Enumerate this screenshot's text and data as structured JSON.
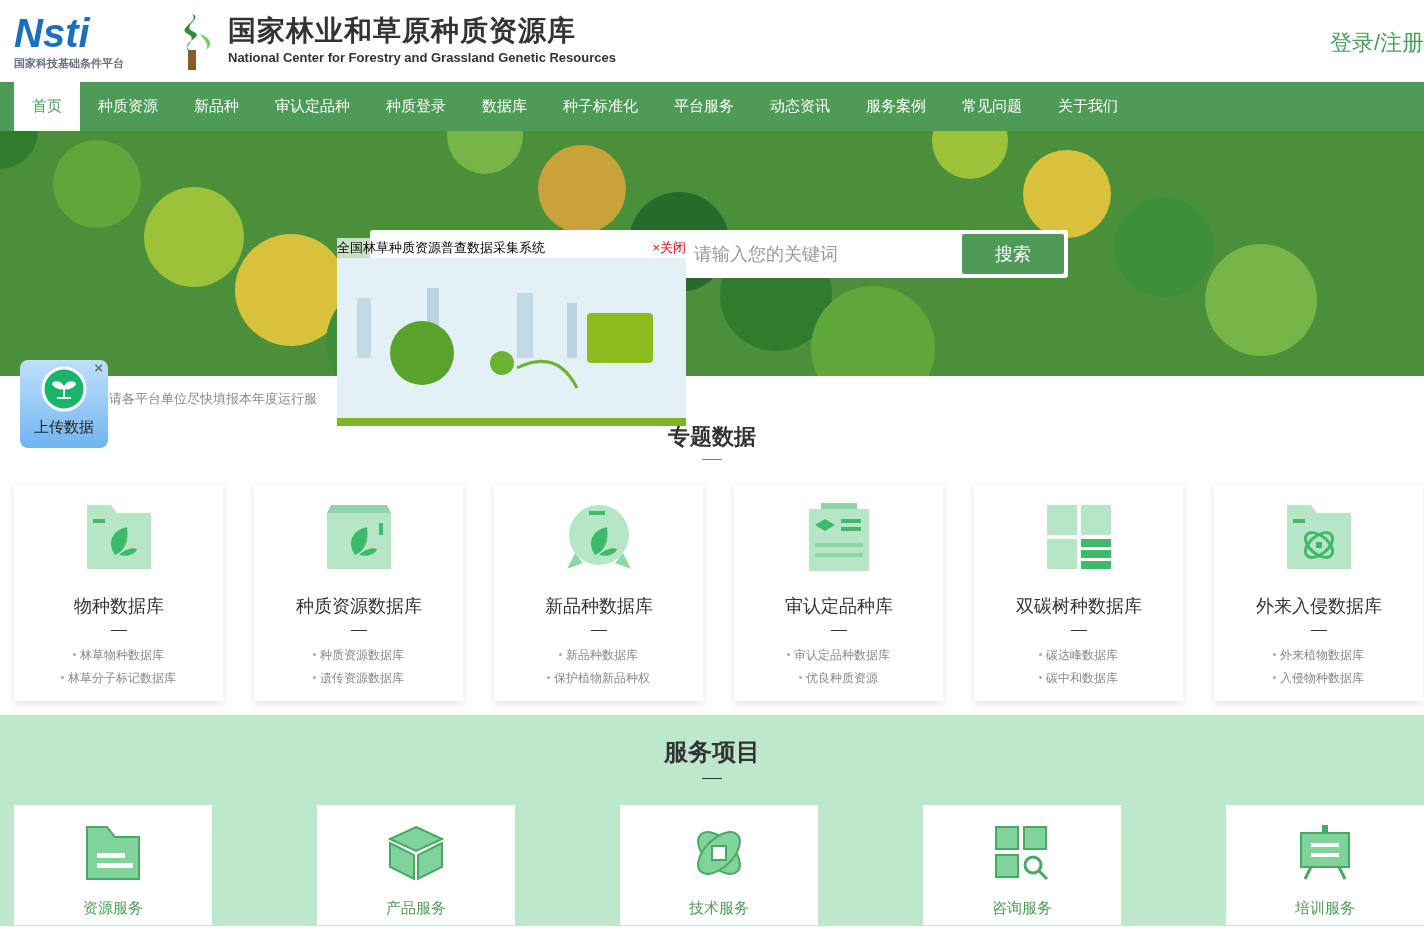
{
  "header": {
    "nsti_logo": "Nsti",
    "nsti_caption": "国家科技基础条件平台",
    "title": "国家林业和草原种质资源库",
    "subtitle": "National Center for Forestry and Grassland Genetic Resources",
    "login": "登录/注册"
  },
  "nav": [
    {
      "label": "首页",
      "selected": true
    },
    {
      "label": "种质资源",
      "selected": false
    },
    {
      "label": "新品种",
      "selected": false
    },
    {
      "label": "审认定品种",
      "selected": false
    },
    {
      "label": "种质登录",
      "selected": false
    },
    {
      "label": "数据库",
      "selected": false
    },
    {
      "label": "种子标准化",
      "selected": false
    },
    {
      "label": "平台服务",
      "selected": false
    },
    {
      "label": "动态资讯",
      "selected": false
    },
    {
      "label": "服务案例",
      "selected": false
    },
    {
      "label": "常见问题",
      "selected": false
    },
    {
      "label": "关于我们",
      "selected": false
    }
  ],
  "search": {
    "placeholder": "请输入您的关键词",
    "button": "搜索"
  },
  "popup": {
    "title": "全国林草种质资源普查数据采集系统",
    "close": "×关闭"
  },
  "upload": {
    "label": "上传数据",
    "close": "×"
  },
  "notice": "请各平台单位尽快填报本年度运行服",
  "topics": {
    "title": "专题数据",
    "cards": [
      {
        "title": "物种数据库",
        "links": [
          "林草物种数据库",
          "林草分子标记数据库"
        ]
      },
      {
        "title": "种质资源数据库",
        "links": [
          "种质资源数据库",
          "遗传资源数据库"
        ]
      },
      {
        "title": "新品种数据库",
        "links": [
          "新品种数据库",
          "保护植物新品种权"
        ]
      },
      {
        "title": "审认定品种库",
        "links": [
          "审认定品种数据库",
          "优良种质资源"
        ]
      },
      {
        "title": "双碳树种数据库",
        "links": [
          "碳达峰数据库",
          "碳中和数据库"
        ]
      },
      {
        "title": "外来入侵数据库",
        "links": [
          "外来植物数据库",
          "入侵物种数据库"
        ]
      }
    ]
  },
  "services": {
    "title": "服务项目",
    "items": [
      "资源服务",
      "产品服务",
      "技术服务",
      "咨询服务",
      "培训服务"
    ]
  }
}
